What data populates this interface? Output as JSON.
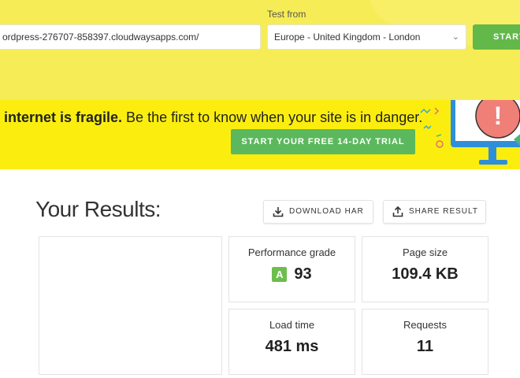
{
  "test_form": {
    "test_from_label": "Test from",
    "url_value": "ordpress-276707-858397.cloudwaysapps.com/",
    "region_value": "Europe - United Kingdom - London",
    "start_label": "START"
  },
  "banner": {
    "headline_bold": "internet is fragile.",
    "headline_rest": " Be the first to know when your site is in danger.",
    "trial_button": "START YOUR FREE 14-DAY TRIAL",
    "illustration_mark": "!"
  },
  "results": {
    "title": "Your Results:",
    "download_har": "DOWNLOAD HAR",
    "share_result": "SHARE RESULT"
  },
  "metrics": {
    "performance": {
      "label": "Performance grade",
      "grade": "A",
      "value": "93",
      "grade_color": "#6ebd4e"
    },
    "page_size": {
      "label": "Page size",
      "value": "109.4 KB"
    },
    "load_time": {
      "label": "Load time",
      "value": "481 ms"
    },
    "requests": {
      "label": "Requests",
      "value": "11"
    }
  },
  "colors": {
    "header_bg": "#f6ec55",
    "banner_bg": "#fbee0f",
    "accent_green": "#5cb85c"
  },
  "icons": {
    "region_dropdown": "chevron-down-icon",
    "download": "download-icon",
    "share": "share-icon"
  }
}
